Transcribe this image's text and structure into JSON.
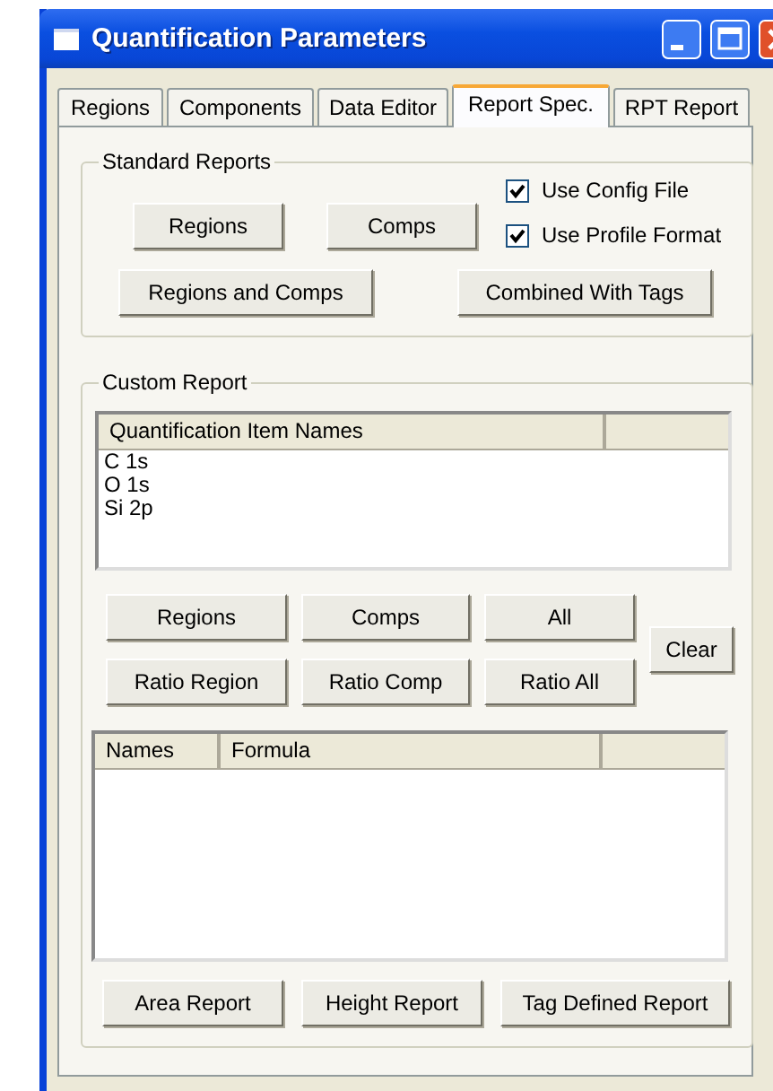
{
  "window": {
    "title": "Quantification Parameters"
  },
  "tabs": [
    {
      "label": "Regions",
      "selected": false
    },
    {
      "label": "Components",
      "selected": false
    },
    {
      "label": "Data Editor",
      "selected": false
    },
    {
      "label": "Report Spec.",
      "selected": true
    },
    {
      "label": "RPT Report",
      "selected": false
    }
  ],
  "standard_reports": {
    "title": "Standard Reports",
    "buttons": [
      "Regions",
      "Comps",
      "Regions and Comps",
      "Combined With Tags"
    ],
    "checkboxes": [
      {
        "label": "Use Config File",
        "checked": true
      },
      {
        "label": "Use Profile Format",
        "checked": true
      }
    ]
  },
  "custom_report": {
    "title": "Custom Report",
    "item_list": {
      "columns": [
        "Quantification Item Names"
      ],
      "rows": [
        "C 1s",
        "O 1s",
        "Si 2p"
      ]
    },
    "buttons": [
      "Regions",
      "Comps",
      "All",
      "Clear",
      "Ratio Region",
      "Ratio Comp",
      "Ratio All"
    ],
    "formula_table": {
      "columns": [
        "Names",
        "Formula"
      ]
    },
    "report_buttons": [
      "Area Report",
      "Height Report",
      "Tag Defined Report"
    ]
  }
}
